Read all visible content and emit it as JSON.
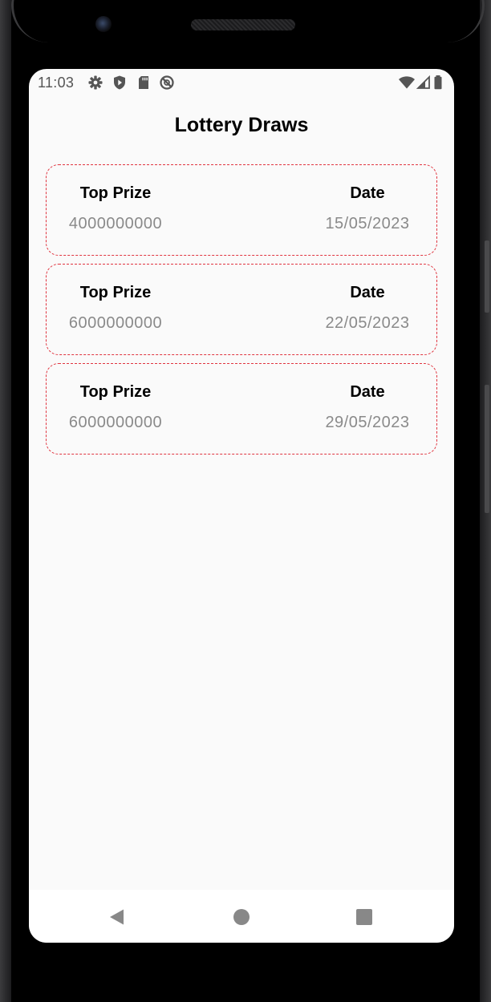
{
  "status_bar": {
    "time": "11:03",
    "icons": [
      "gear-icon",
      "shield-play-icon",
      "sd-card-icon",
      "no-sync-icon"
    ],
    "right_icons": [
      "wifi-icon",
      "cell-signal-icon",
      "battery-icon"
    ]
  },
  "app": {
    "title": "Lottery Draws",
    "accent_color": "#e0343f"
  },
  "labels": {
    "prize": "Top Prize",
    "date": "Date"
  },
  "draws": [
    {
      "prize": "4000000000",
      "date": "15/05/2023"
    },
    {
      "prize": "6000000000",
      "date": "22/05/2023"
    },
    {
      "prize": "6000000000",
      "date": "29/05/2023"
    }
  ],
  "nav_bar": {
    "buttons": [
      "back-icon",
      "home-icon",
      "recents-icon"
    ]
  }
}
